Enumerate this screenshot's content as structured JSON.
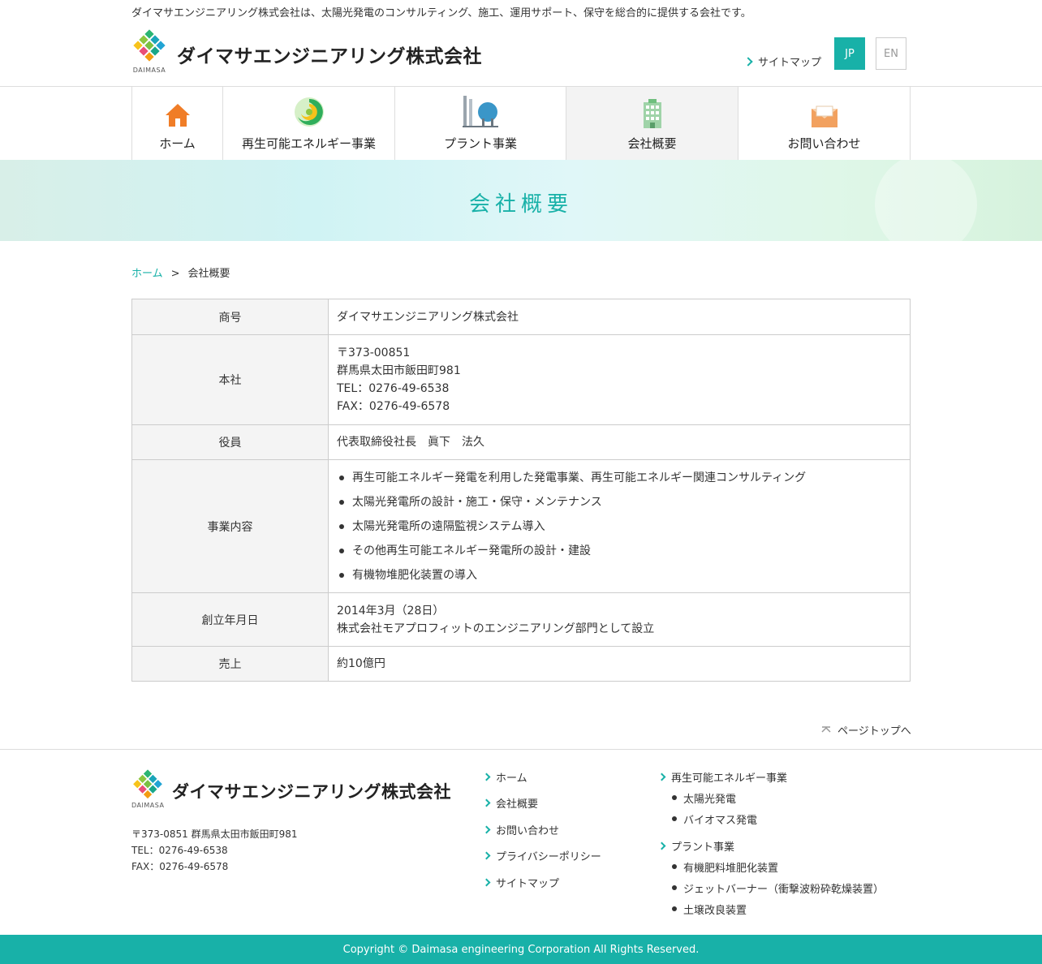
{
  "header": {
    "tagline": "ダイマサエンジニアリング株式会社は、太陽光発電のコンサルティング、施工、運用サポート、保守を総合的に提供する会社です。",
    "company_name": "ダイマサエンジニアリング株式会社",
    "logo_sub": "DAIMASA",
    "sitemap": "サイトマップ",
    "lang_jp": "JP",
    "lang_en": "EN"
  },
  "nav": {
    "home": "ホーム",
    "renewable": "再生可能エネルギー事業",
    "plant": "プラント事業",
    "about": "会社概要",
    "contact": "お問い合わせ"
  },
  "hero": {
    "title": "会社概要"
  },
  "breadcrumb": {
    "home": "ホーム",
    "sep": ">",
    "current": "会社概要"
  },
  "table": {
    "trade_name": {
      "label": "商号",
      "value": "ダイマサエンジニアリング株式会社"
    },
    "hq": {
      "label": "本社",
      "lines": [
        "〒373-00851",
        "群馬県太田市飯田町981",
        "TEL：0276-49-6538",
        "FAX：0276-49-6578"
      ]
    },
    "officers": {
      "label": "役員",
      "value": "代表取締役社長　眞下　法久"
    },
    "business": {
      "label": "事業内容",
      "items": [
        "再生可能エネルギー発電を利用した発電事業、再生可能エネルギー関連コンサルティング",
        "太陽光発電所の設計・施工・保守・メンテナンス",
        "太陽光発電所の遠隔監視システム導入",
        "その他再生可能エネルギー発電所の設計・建設",
        "有機物堆肥化装置の導入"
      ]
    },
    "founded": {
      "label": "創立年月日",
      "lines": [
        "2014年3月（28日）",
        "株式会社モアプロフィットのエンジニアリング部門として設立"
      ]
    },
    "sales": {
      "label": "売上",
      "value": "約10億円"
    }
  },
  "pagetop": "ページトップへ",
  "footer": {
    "company_name": "ダイマサエンジニアリング株式会社",
    "logo_sub": "DAIMASA",
    "address": "〒373-0851 群馬県太田市飯田町981",
    "tel": "TEL：0276-49-6538",
    "fax": "FAX：0276-49-6578",
    "links": [
      "ホーム",
      "会社概要",
      "お問い合わせ",
      "プライバシーポリシー",
      "サイトマップ"
    ],
    "renewable": {
      "label": "再生可能エネルギー事業",
      "items": [
        "太陽光発電",
        "バイオマス発電"
      ]
    },
    "plant": {
      "label": "プラント事業",
      "items": [
        "有機肥料堆肥化装置",
        "ジェットバーナー（衝撃波粉砕乾燥装置）",
        "土壌改良装置"
      ]
    },
    "copyright": "Copyright © Daimasa engineering Corporation All Rights Reserved."
  },
  "colors": {
    "accent": "#18b1a8"
  }
}
